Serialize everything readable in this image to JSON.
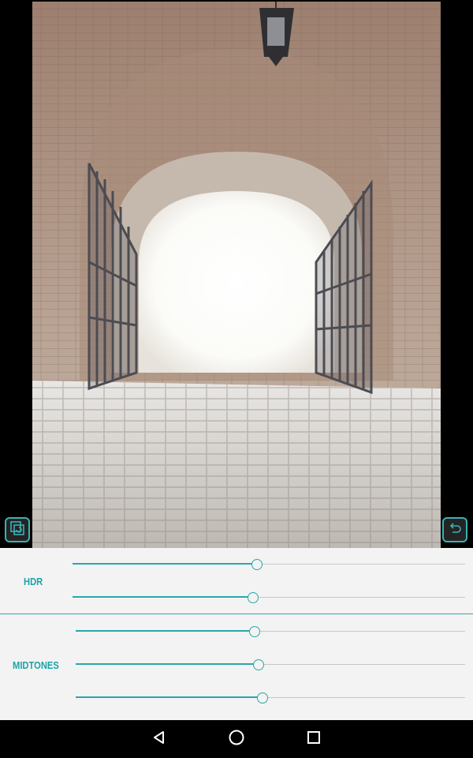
{
  "adjustments": {
    "hdr": {
      "label": "HDR",
      "sliders": [
        {
          "name": "hdr-slider-1",
          "value": 0.47
        },
        {
          "name": "hdr-slider-2",
          "value": 0.46
        }
      ]
    },
    "midtones": {
      "label": "MIDTONES",
      "sliders": [
        {
          "name": "midtones-slider-1",
          "value": 0.46
        },
        {
          "name": "midtones-slider-2",
          "value": 0.47
        },
        {
          "name": "midtones-slider-3",
          "value": 0.48
        }
      ]
    }
  },
  "toolbar": {
    "compare_icon": "compare-icon",
    "undo_icon": "undo-icon"
  },
  "navigation": {
    "back_icon": "back-triangle-icon",
    "home_icon": "home-circle-icon",
    "recents_icon": "recents-square-icon"
  },
  "colors": {
    "accent": "#2aa7ab",
    "panel_bg": "#f3f3f3"
  }
}
